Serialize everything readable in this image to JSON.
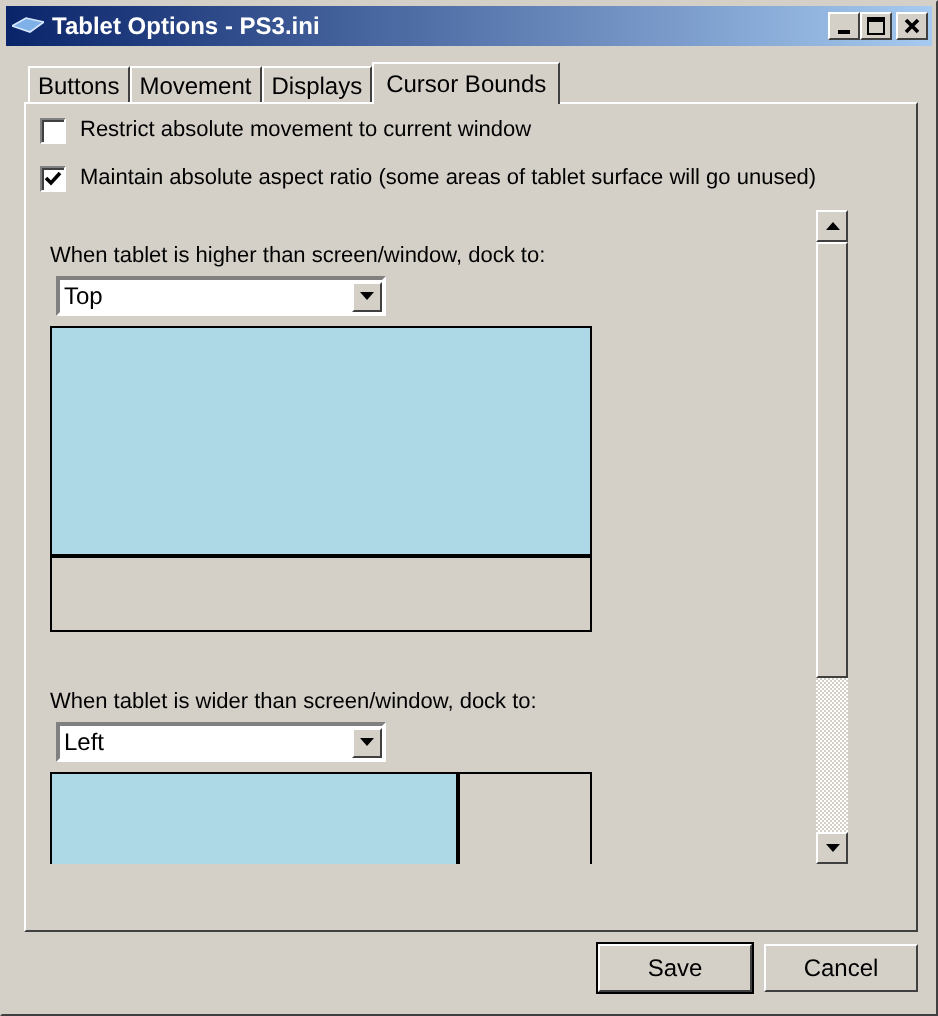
{
  "window": {
    "title": "Tablet Options - PS3.ini"
  },
  "tabs": [
    {
      "label": "Buttons",
      "selected": false
    },
    {
      "label": "Movement",
      "selected": false
    },
    {
      "label": "Displays",
      "selected": false
    },
    {
      "label": "Cursor Bounds",
      "selected": true
    }
  ],
  "options": [
    {
      "label": "Restrict absolute movement to current window",
      "checked": false
    },
    {
      "label": "Maintain absolute aspect ratio (some areas of tablet surface will go unused)",
      "checked": true
    }
  ],
  "dock_sections": [
    {
      "label": "When tablet is higher than screen/window, dock to:",
      "value": "Top",
      "kind": "vertical"
    },
    {
      "label": "When tablet is wider than screen/window, dock to:",
      "value": "Left",
      "kind": "horizontal"
    }
  ],
  "buttons": [
    {
      "label": "Save",
      "default": true
    },
    {
      "label": "Cancel",
      "default": false
    }
  ]
}
